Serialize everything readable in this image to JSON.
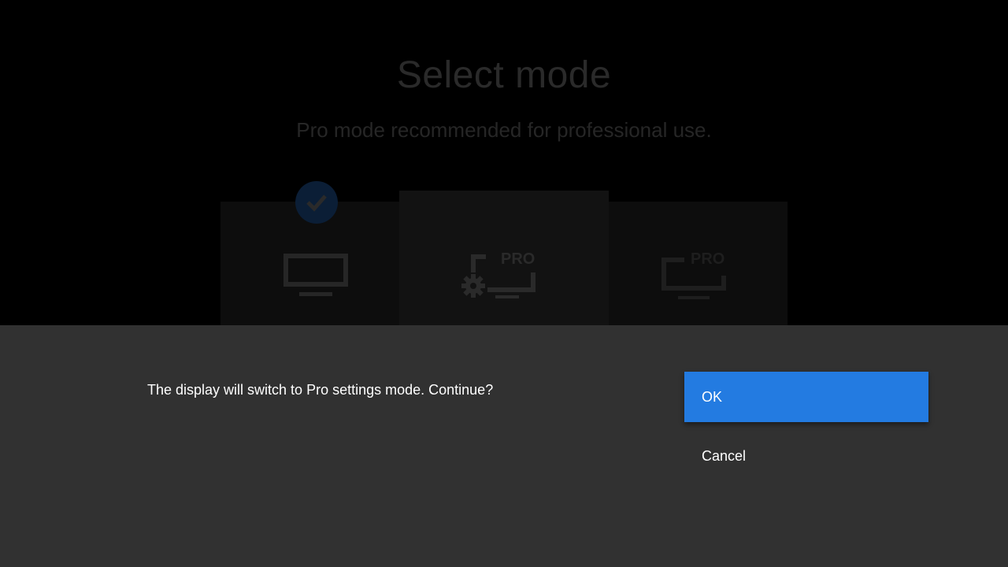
{
  "background": {
    "title": "Select mode",
    "subtitle": "Pro mode recommended for professional use.",
    "modes": [
      {
        "icon": "tv-icon",
        "selected": true
      },
      {
        "icon": "pro-settings-icon",
        "selected": false,
        "badge": "PRO"
      },
      {
        "icon": "pro-display-icon",
        "selected": false,
        "badge": "PRO"
      }
    ]
  },
  "dialog": {
    "message": "The display will switch to Pro settings mode. Continue?",
    "ok_label": "OK",
    "cancel_label": "Cancel"
  },
  "colors": {
    "accent": "#237be1",
    "dialog_bg": "#313131",
    "checkmark_badge": "#0b1e36"
  }
}
